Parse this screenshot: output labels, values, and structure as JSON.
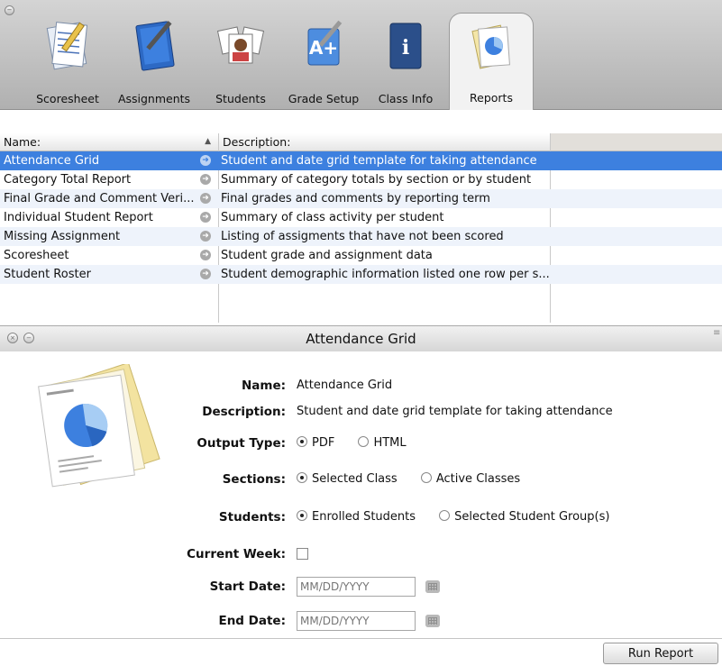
{
  "toolbar": {
    "tabs": [
      {
        "label": "Scoresheet",
        "icon": "scoresheet-icon"
      },
      {
        "label": "Assignments",
        "icon": "assignments-icon"
      },
      {
        "label": "Students",
        "icon": "students-icon"
      },
      {
        "label": "Grade Setup",
        "icon": "grade-setup-icon"
      },
      {
        "label": "Class Info",
        "icon": "class-info-icon"
      },
      {
        "label": "Reports",
        "icon": "reports-icon"
      }
    ],
    "active_tab": "Reports"
  },
  "table": {
    "columns": {
      "name": "Name:",
      "description": "Description:"
    },
    "sort": "ascending",
    "rows": [
      {
        "name": "Attendance Grid",
        "description": "Student and date grid template for taking attendance",
        "selected": true
      },
      {
        "name": "Category Total Report",
        "description": "Summary of category totals by section or by student"
      },
      {
        "name": "Final Grade and Comment Veri...",
        "description": "Final grades and comments by reporting term"
      },
      {
        "name": "Individual Student Report",
        "description": "Summary of class activity per student"
      },
      {
        "name": "Missing Assignment",
        "description": "Listing of assigments that have not been scored"
      },
      {
        "name": "Scoresheet",
        "description": "Student grade and assignment data"
      },
      {
        "name": "Student Roster",
        "description": "Student demographic information listed one row per s..."
      }
    ]
  },
  "detail": {
    "title": "Attendance Grid",
    "name_label": "Name:",
    "name_value": "Attendance Grid",
    "description_label": "Description:",
    "description_value": "Student and date grid template for taking attendance",
    "output_label": "Output Type:",
    "output_options": [
      "PDF",
      "HTML"
    ],
    "output_selected": "PDF",
    "sections_label": "Sections:",
    "sections_options": [
      "Selected Class",
      "Active Classes"
    ],
    "sections_selected": "Selected Class",
    "students_label": "Students:",
    "students_options": [
      "Enrolled Students",
      "Selected Student Group(s)"
    ],
    "students_selected": "Enrolled Students",
    "current_week_label": "Current Week:",
    "current_week_checked": false,
    "start_label": "Start Date:",
    "start_placeholder": "MM/DD/YYYY",
    "end_label": "End Date:",
    "end_placeholder": "MM/DD/YYYY"
  },
  "footer": {
    "run_label": "Run Report"
  },
  "colors": {
    "selection": "#3d80df",
    "toolbar": "#c4c4c4"
  }
}
